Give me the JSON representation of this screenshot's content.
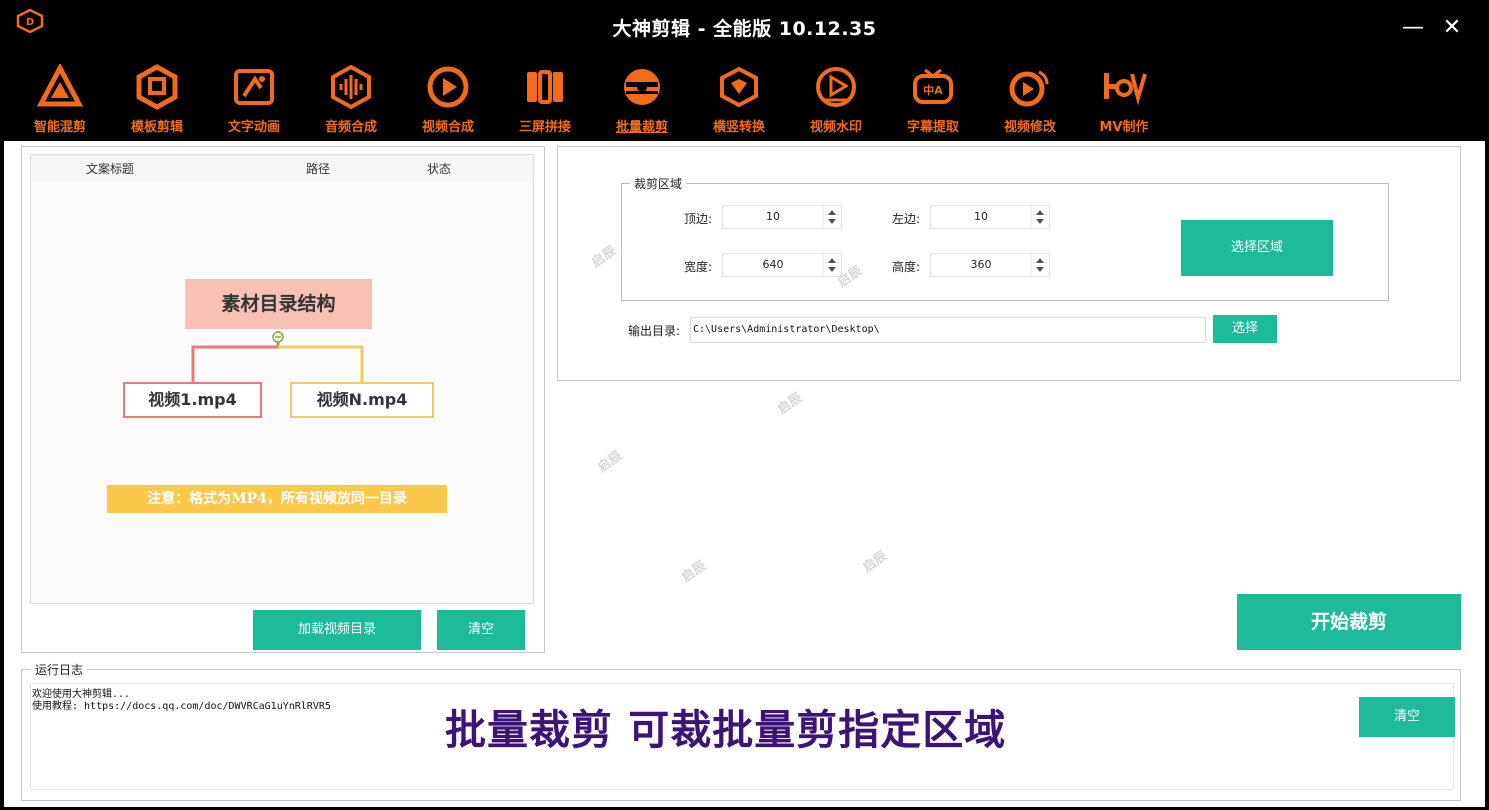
{
  "window": {
    "title": "大神剪辑 - 全能版 10.12.35",
    "minimize": "—",
    "close": "✕"
  },
  "toolbar": {
    "accent_color": "#f26b1d",
    "items": [
      {
        "label": "智能混剪",
        "icon": "triangle-logo-icon"
      },
      {
        "label": "模板剪辑",
        "icon": "hexagon-template-icon"
      },
      {
        "label": "文字动画",
        "icon": "text-card-icon"
      },
      {
        "label": "音频合成",
        "icon": "audio-wave-icon"
      },
      {
        "label": "视频合成",
        "icon": "video-circle-icon"
      },
      {
        "label": "三屏拼接",
        "icon": "split-screen-icon"
      },
      {
        "label": "批量裁剪",
        "icon": "crop-icon",
        "active": true
      },
      {
        "label": "横竖转换",
        "icon": "rotate-cube-icon"
      },
      {
        "label": "视频水印",
        "icon": "watermark-icon"
      },
      {
        "label": "字幕提取",
        "icon": "subtitle-tv-icon"
      },
      {
        "label": "视频修改",
        "icon": "video-edit-icon"
      },
      {
        "label": "MV制作",
        "icon": "mv-logo-icon"
      }
    ]
  },
  "file_list": {
    "columns": [
      "文案标题",
      "路径",
      "状态"
    ],
    "diagram": {
      "root": "素材目录结构",
      "children": [
        "视频1.mp4",
        "视频N.mp4"
      ],
      "note": "注意：格式为MP4，所有视频放同一目录"
    },
    "load_button": "加载视频目录",
    "clear_button": "清空"
  },
  "crop_area": {
    "group_title": "裁剪区域",
    "top_label": "顶边:",
    "top_value": "10",
    "left_label": "左边:",
    "left_value": "10",
    "width_label": "宽度:",
    "width_value": "640",
    "height_label": "高度:",
    "height_value": "360",
    "select_area_button": "选择区域"
  },
  "output": {
    "label": "输出目录:",
    "path": "C:\\Users\\Administrator\\Desktop\\",
    "choose_button": "选择"
  },
  "start_button": "开始裁剪",
  "log": {
    "title": "运行日志",
    "lines": [
      "欢迎使用大神剪辑...",
      "使用教程: https://docs.qq.com/doc/DWVRCaG1uYnRlRVR5"
    ],
    "clear_button": "清空",
    "banner": "批量裁剪 可裁批量剪指定区域",
    "banner_color": "#3c1478"
  },
  "watermark": "启辰",
  "button_color": "#1dbb99"
}
